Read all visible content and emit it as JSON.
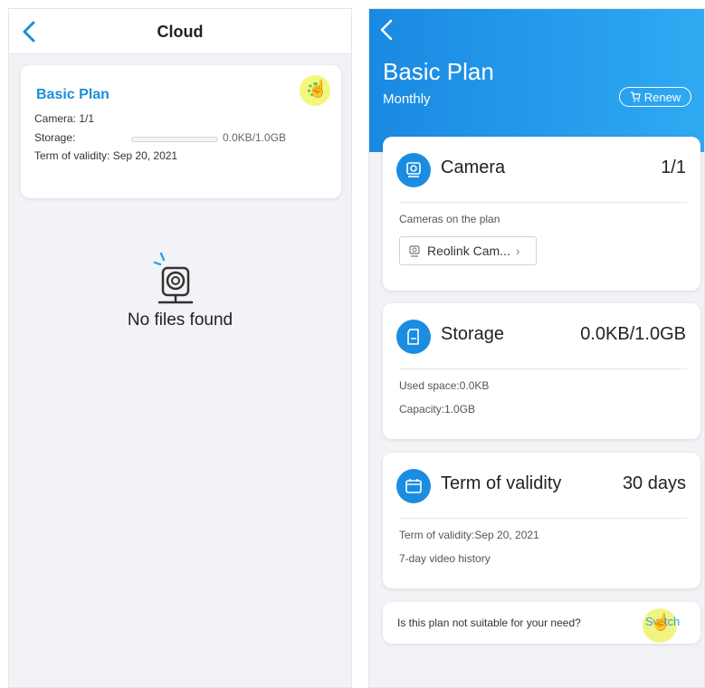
{
  "left": {
    "title": "Cloud",
    "plan": {
      "name": "Basic Plan",
      "camera_label": "Camera:",
      "camera_value": "1/1",
      "storage_label": "Storage:",
      "storage_value": "0.0KB/1.0GB",
      "storage_fraction": 0.0,
      "validity_label": "Term of validity:",
      "validity_value": "Sep 20, 2021"
    },
    "empty_text": "No files found"
  },
  "right": {
    "plan_title": "Basic Plan",
    "plan_period": "Monthly",
    "renew_label": "Renew",
    "camera": {
      "title": "Camera",
      "value": "1/1",
      "caption": "Cameras on the plan",
      "chip_label": "Reolink Cam..."
    },
    "storage": {
      "title": "Storage",
      "value": "0.0KB/1.0GB",
      "used": "Used space:0.0KB",
      "capacity": "Capacity:1.0GB"
    },
    "validity": {
      "title": "Term of validity",
      "value": "30 days",
      "date": "Term of validity:Sep 20, 2021",
      "history": "7-day video history"
    },
    "bottom": {
      "question": "Is this plan not suitable for your need?",
      "switch_label": "Switch"
    }
  },
  "colors": {
    "accent": "#1c8fd9",
    "hero_gradient_start": "#1a89e2",
    "hero_gradient_end": "#2eaaf2",
    "highlight": "#f3f77a"
  },
  "icons": [
    "back-arrow-icon",
    "settings-icon",
    "camera-icon",
    "sd-card-icon",
    "calendar-icon",
    "cart-icon",
    "chevron-right-icon"
  ]
}
